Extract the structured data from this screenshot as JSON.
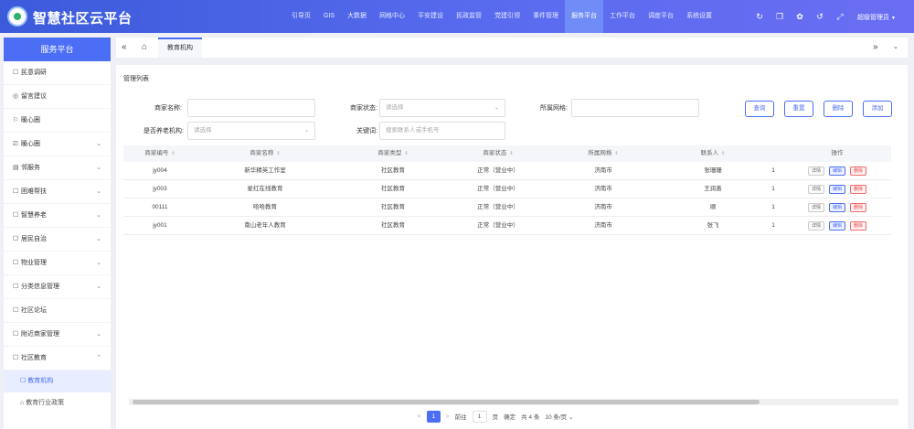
{
  "app": {
    "title": "智慧社区云平台"
  },
  "topnav": [
    {
      "label": "引导页",
      "active": false
    },
    {
      "label": "GIS",
      "active": false
    },
    {
      "label": "大数据",
      "active": false
    },
    {
      "label": "网格中心",
      "active": false
    },
    {
      "label": "平安建设",
      "active": false
    },
    {
      "label": "民政监管",
      "active": false
    },
    {
      "label": "党建引领",
      "active": false
    },
    {
      "label": "事件管理",
      "active": false
    },
    {
      "label": "服务平台",
      "active": true
    },
    {
      "label": "工作平台",
      "active": false
    },
    {
      "label": "调度平台",
      "active": false
    },
    {
      "label": "系统设置",
      "active": false
    }
  ],
  "top_icons": [
    {
      "name": "refresh-icon",
      "glyph": "↻"
    },
    {
      "name": "copy-icon",
      "glyph": "❐"
    },
    {
      "name": "palette-icon",
      "glyph": "✿"
    },
    {
      "name": "undo-icon",
      "glyph": "↺"
    },
    {
      "name": "fullscreen-icon",
      "glyph": "⤢"
    }
  ],
  "user": {
    "name": "超级管理员"
  },
  "sidebar": {
    "header": "服务平台",
    "items": [
      {
        "label": "民意调研",
        "icon": "☐",
        "chevron": false
      },
      {
        "label": "留言建议",
        "icon": "◎",
        "chevron": false
      },
      {
        "label": "暖心圈",
        "icon": "⚐",
        "chevron": false
      },
      {
        "label": "暖心圈",
        "icon": "⎚",
        "chevron": true
      },
      {
        "label": "邻服务",
        "icon": "▤",
        "chevron": true
      },
      {
        "label": "困难帮扶",
        "icon": "☐",
        "chevron": true
      },
      {
        "label": "智慧养老",
        "icon": "☐",
        "chevron": true
      },
      {
        "label": "居民自治",
        "icon": "☐",
        "chevron": true
      },
      {
        "label": "物业管理",
        "icon": "☐",
        "chevron": true
      },
      {
        "label": "分类信息管理",
        "icon": "☐",
        "chevron": true
      },
      {
        "label": "社区论坛",
        "icon": "☐",
        "chevron": false
      },
      {
        "label": "附近商家管理",
        "icon": "☐",
        "chevron": true
      },
      {
        "label": "社区教育",
        "icon": "☐",
        "chevron": "up"
      }
    ],
    "subitems": [
      {
        "label": "教育机构",
        "icon": "☐",
        "active": true
      },
      {
        "label": "教育行业政策",
        "icon": "⌂",
        "active": false
      }
    ]
  },
  "tabs": {
    "current": "教育机构"
  },
  "panel": {
    "title": "管理列表",
    "filters": {
      "merchant_name_label": "商家名称:",
      "merchant_name_placeholder": "",
      "merchant_status_label": "商家状态:",
      "merchant_status_placeholder": "请选择",
      "grid_label": "所属网格:",
      "grid_placeholder": "",
      "elderly_label": "是否养老机构:",
      "elderly_placeholder": "请选择",
      "keyword_label": "关键词:",
      "keyword_placeholder": "搜索联系人或手机号"
    },
    "buttons": {
      "query": "查询",
      "reset": "重置",
      "delete": "删除",
      "add": "添加"
    }
  },
  "table": {
    "columns": [
      "商家编号",
      "商家名称",
      "商家类型",
      "商家状态",
      "所属网格",
      "联系人",
      "",
      "操作"
    ],
    "rows": [
      {
        "id": "jy004",
        "name": "新华精英工作室",
        "type": "社区教育",
        "status": "正常（营业中）",
        "grid": "济南市",
        "contact": "张珊珊",
        "extra": "1"
      },
      {
        "id": "jy003",
        "name": "星红在线教育",
        "type": "社区教育",
        "status": "正常（营业中）",
        "grid": "济南市",
        "contact": "王润善",
        "extra": "1"
      },
      {
        "id": "00111",
        "name": "哈哈教育",
        "type": "社区教育",
        "status": "正常（营业中）",
        "grid": "济南市",
        "contact": "顺",
        "extra": "1"
      },
      {
        "id": "jy001",
        "name": "南山老年人教育",
        "type": "社区教育",
        "status": "正常（营业中）",
        "grid": "济南市",
        "contact": "张飞",
        "extra": "1"
      }
    ],
    "row_actions": {
      "view": "详情",
      "edit": "编辑",
      "delete": "删除"
    }
  },
  "pagination": {
    "prev": "<",
    "current": "1",
    "next": ">",
    "goto_label": "前往",
    "goto_value": "1",
    "goto_unit": "页",
    "confirm": "确定",
    "total": "共 4 条",
    "page_size": "10 条/页"
  }
}
